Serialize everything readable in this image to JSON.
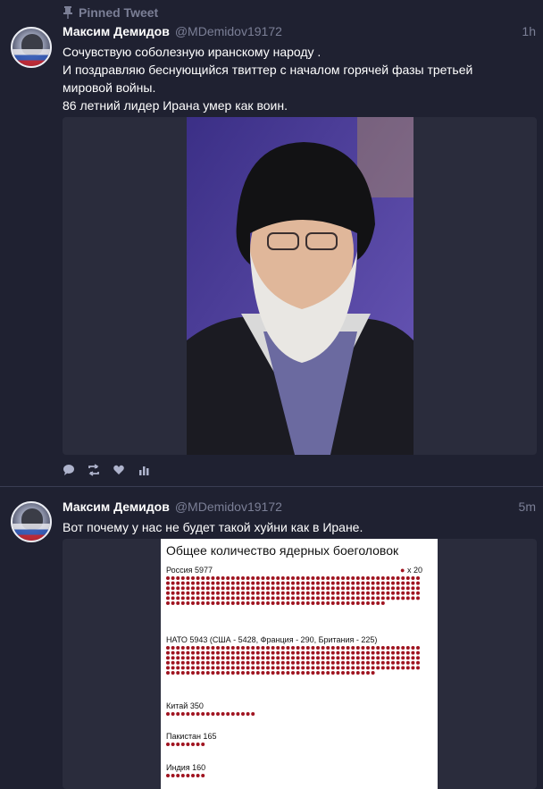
{
  "tweets": [
    {
      "pinned_label": "Pinned Tweet",
      "name": "Максим Демидов",
      "handle": "@MDemidov19172",
      "time": "1h",
      "lines": [
        "Сочувствую соболезную иранскому народу .",
        "И поздравляю беснующийся твиттер с началом горячей фазы третьей",
        "мировой войны.",
        "86 летний лидер Ирана умер как воин."
      ]
    },
    {
      "name": "Максим Демидов",
      "handle": "@MDemidov19172",
      "time": "5m",
      "lines": [
        "Вот почему у нас не будет такой хуйни как в Иране."
      ]
    }
  ],
  "icons": [
    "pin-icon",
    "reply-icon",
    "retweet-icon",
    "like-icon",
    "stats-icon"
  ],
  "colors": {
    "background": "#1f2131",
    "muted": "#7b7f96",
    "dots": "#a01420"
  },
  "infographic": {
    "title": "Общее количество ядерных боеголовок",
    "legend": "x 20",
    "rows": [
      {
        "label": "Россия 5977",
        "value": 5977
      },
      {
        "label": "НАТО 5943 (США - 5428, Франция - 290, Британия - 225)",
        "value": 5943
      },
      {
        "label": "Китай 350",
        "value": 350
      },
      {
        "label": "Пакистан 165",
        "value": 165
      },
      {
        "label": "Индия 160",
        "value": 160
      }
    ]
  }
}
